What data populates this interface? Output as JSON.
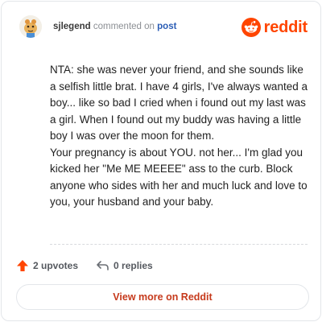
{
  "header": {
    "username": "sjlegend",
    "action_text": "commented on",
    "post_label": "post",
    "brand": "reddit"
  },
  "comment": {
    "paragraphs": [
      "NTA: she was never your friend, and she sounds like a selfish little brat. I have 4 girls, I've always wanted a boy... like so bad I cried when i found out my last was a girl. When I found out my buddy was having a little boy I was over the moon for them.",
      "Your pregnancy is about YOU. not her... I'm glad you kicked her \"Me ME MEEEE\" ass to the curb. Block anyone who sides with her and much luck and love to you, your husband and your baby."
    ]
  },
  "footer": {
    "upvotes": "2 upvotes",
    "replies": "0 replies",
    "view_button": "View more on Reddit"
  },
  "colors": {
    "brand": "#ff4500",
    "link": "#2b5db5",
    "button_text": "#c63a1c"
  },
  "icons": {
    "upvote": "upvote-arrow-icon",
    "reply": "reply-arrow-icon",
    "logo": "reddit-snoo-icon"
  }
}
